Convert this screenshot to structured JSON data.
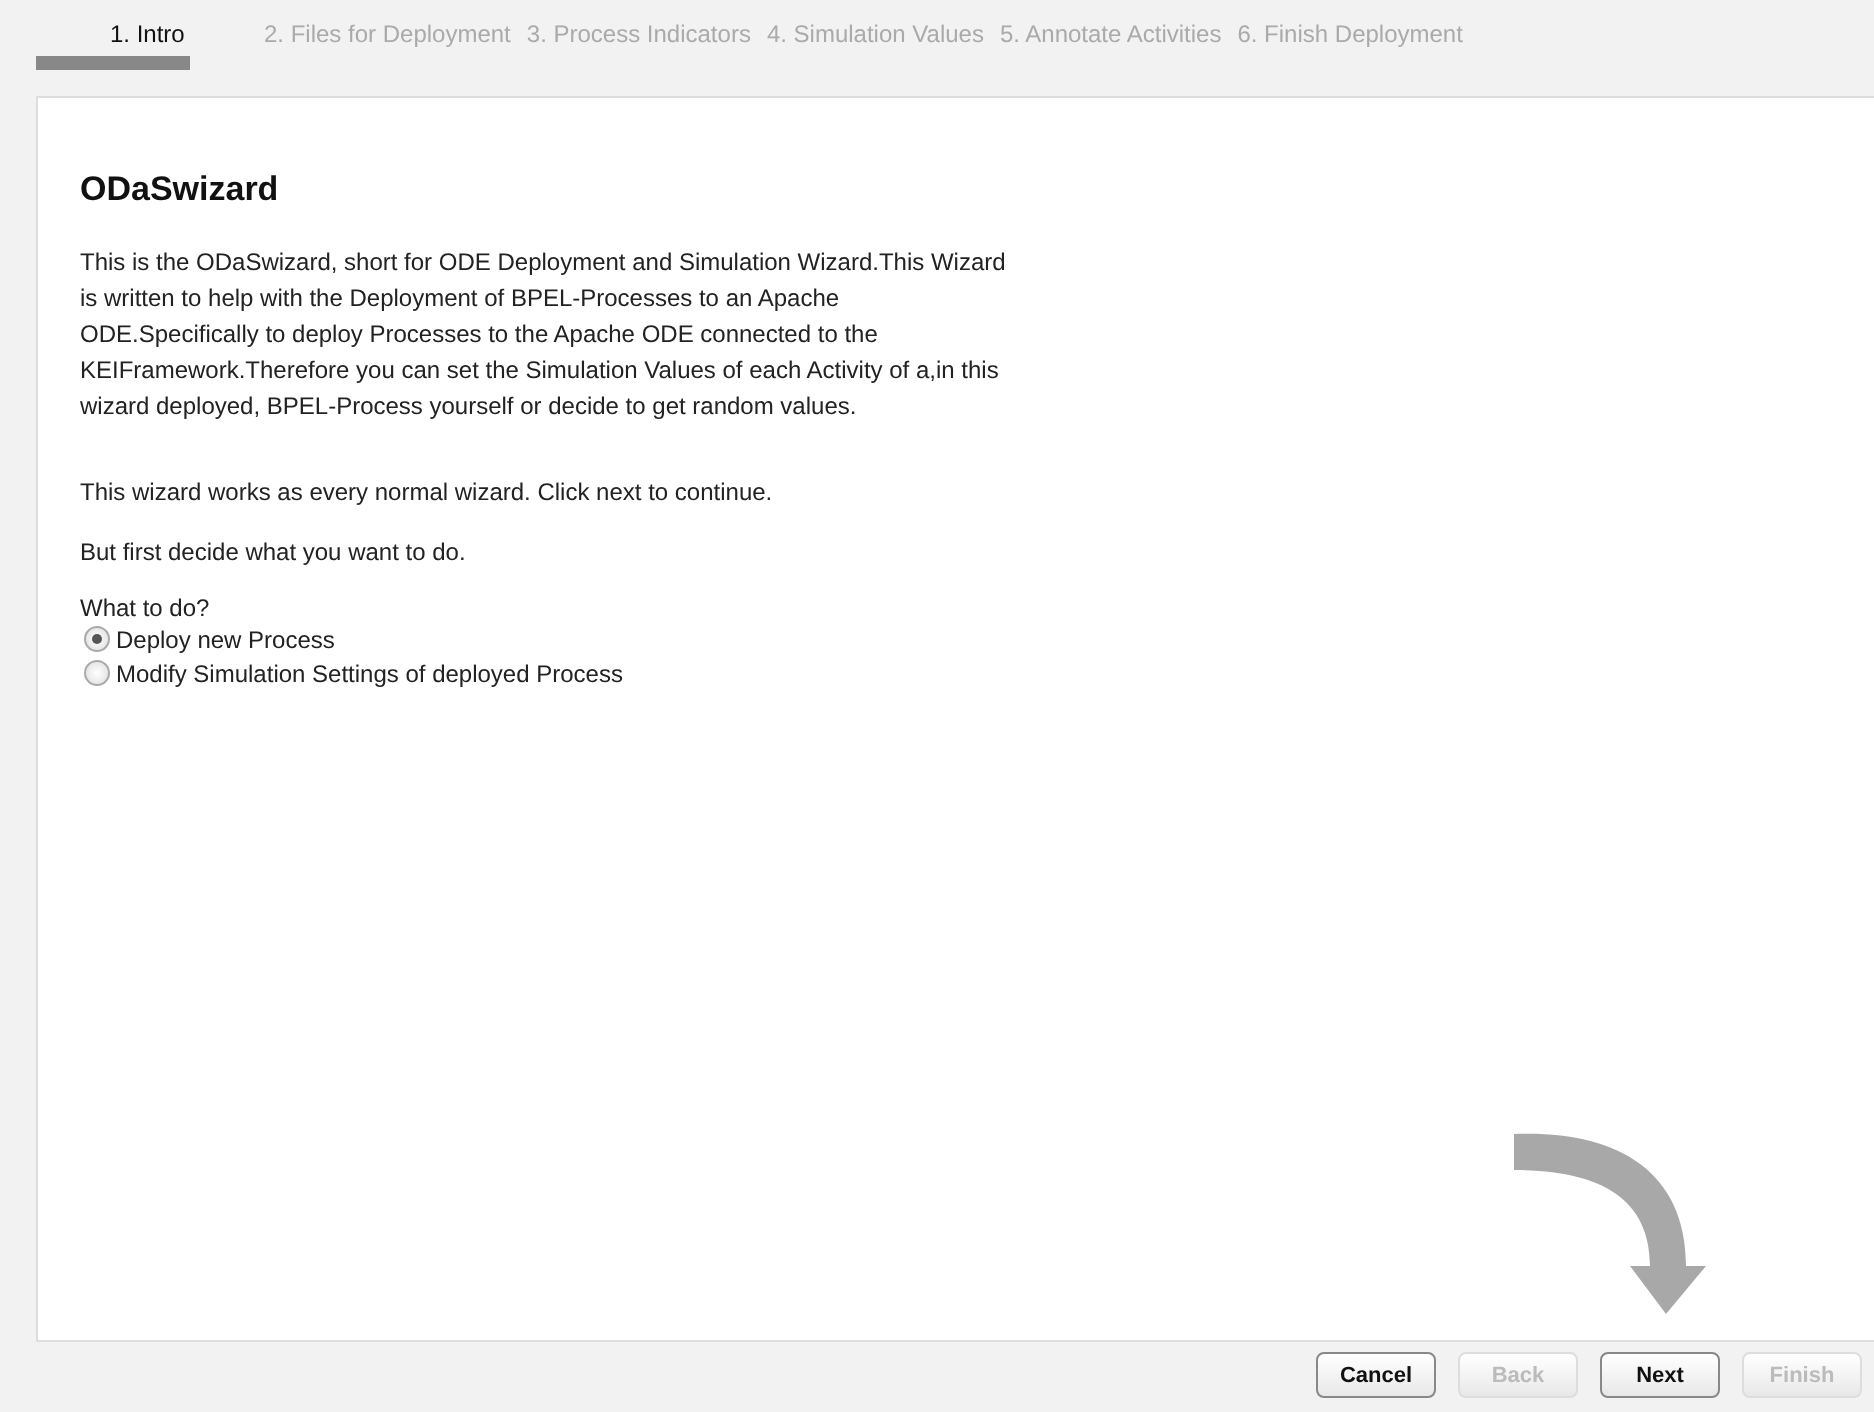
{
  "steps": [
    {
      "label": "1. Intro",
      "selected": true
    },
    {
      "label": "2. Files for Deployment",
      "selected": false
    },
    {
      "label": "3. Process Indicators",
      "selected": false
    },
    {
      "label": "4. Simulation Values",
      "selected": false
    },
    {
      "label": "5. Annotate Activities",
      "selected": false
    },
    {
      "label": "6. Finish Deployment",
      "selected": false
    }
  ],
  "content": {
    "title": "ODaSwizard",
    "paragraphs": [
      "This is the ODaSwizard, short for ODE Deployment and Simulation Wizard.This Wizard is written to help with the Deployment of BPEL-Processes to an Apache ODE.Specifically to deploy Processes to the Apache ODE connected to the KEIFramework.Therefore you can set the Simulation Values of each Activity of a,in this wizard deployed, BPEL-Process yourself or decide to get random values.",
      "This wizard works as every normal wizard. Click next to continue.",
      "But first decide what you want to do."
    ],
    "question": "What to do?",
    "options": [
      {
        "label": "Deploy new Process",
        "selected": true
      },
      {
        "label": "Modify Simulation Settings of deployed Process",
        "selected": false
      }
    ]
  },
  "buttons": [
    {
      "label": "Cancel",
      "disabled": false
    },
    {
      "label": "Back",
      "disabled": true
    },
    {
      "label": "Next",
      "disabled": false
    },
    {
      "label": "Finish",
      "disabled": true
    }
  ]
}
